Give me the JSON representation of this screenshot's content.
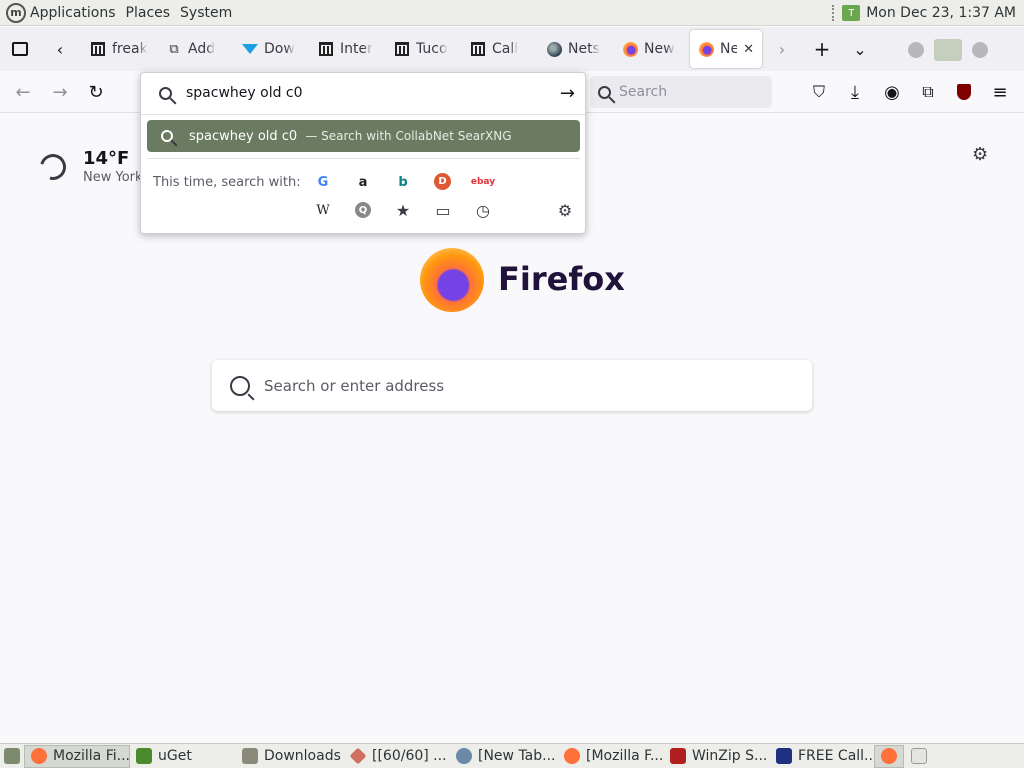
{
  "system_panel": {
    "menus": [
      "Applications",
      "Places",
      "System"
    ],
    "clock": "Mon Dec 23,  1:37 AM"
  },
  "tabs": [
    {
      "label": "freak",
      "icon": "library-icon"
    },
    {
      "label": "Add",
      "icon": "extension-icon"
    },
    {
      "label": "Dow",
      "icon": "download-icon"
    },
    {
      "label": "Inter",
      "icon": "library-icon"
    },
    {
      "label": "Tuco",
      "icon": "library-icon"
    },
    {
      "label": "Call",
      "icon": "library-icon"
    },
    {
      "label": "Nets",
      "icon": "globe-icon"
    },
    {
      "label": "New",
      "icon": "firefox-icon"
    },
    {
      "label": "Ne",
      "icon": "firefox-icon",
      "active": true
    }
  ],
  "toolbar": {
    "search_placeholder": "Search"
  },
  "urlbar": {
    "value": "spacwhey old c0",
    "suggestion_text": "spacwhey old c0",
    "suggestion_sub": "— Search with CollabNet SearXNG",
    "oneoff_label": "This time, search with:",
    "engines": [
      {
        "name": "google",
        "glyph": "G",
        "color": "#4285f4"
      },
      {
        "name": "amazon",
        "glyph": "a",
        "color": "#222222"
      },
      {
        "name": "bing",
        "glyph": "b",
        "color": "#0c8484"
      },
      {
        "name": "duckduckgo",
        "glyph": "D",
        "color": "#de5833"
      },
      {
        "name": "ebay",
        "glyph": "ebay",
        "color": "#e53238"
      },
      {
        "name": "wikipedia",
        "glyph": "W",
        "color": "#222222"
      },
      {
        "name": "searx",
        "glyph": "Q",
        "color": "#888888"
      },
      {
        "name": "bookmarks",
        "glyph": "★",
        "color": "#3a3944"
      },
      {
        "name": "tabs",
        "glyph": "▭",
        "color": "#3a3944"
      },
      {
        "name": "history",
        "glyph": "◷",
        "color": "#3a3944"
      }
    ]
  },
  "weather": {
    "temp": "14°F",
    "city": "New York"
  },
  "brand": {
    "name": "Firefox"
  },
  "new_tab": {
    "search_placeholder": "Search or enter address"
  },
  "taskbar": {
    "tasks": [
      {
        "label": "Mozilla Fi...",
        "color": "#ff7139",
        "active": true
      },
      {
        "label": "uGet",
        "color": "#4a8a2a"
      },
      {
        "label": "Downloads",
        "color": "#8a8a7a"
      },
      {
        "label": "[[60/60] ...",
        "color": "#d07060"
      },
      {
        "label": "[New Tab...",
        "color": "#6a8aa8"
      },
      {
        "label": "[Mozilla F...",
        "color": "#ff7139"
      },
      {
        "label": "WinZip S...",
        "color": "#b02020"
      },
      {
        "label": "FREE Call...",
        "color": "#203080"
      }
    ]
  }
}
